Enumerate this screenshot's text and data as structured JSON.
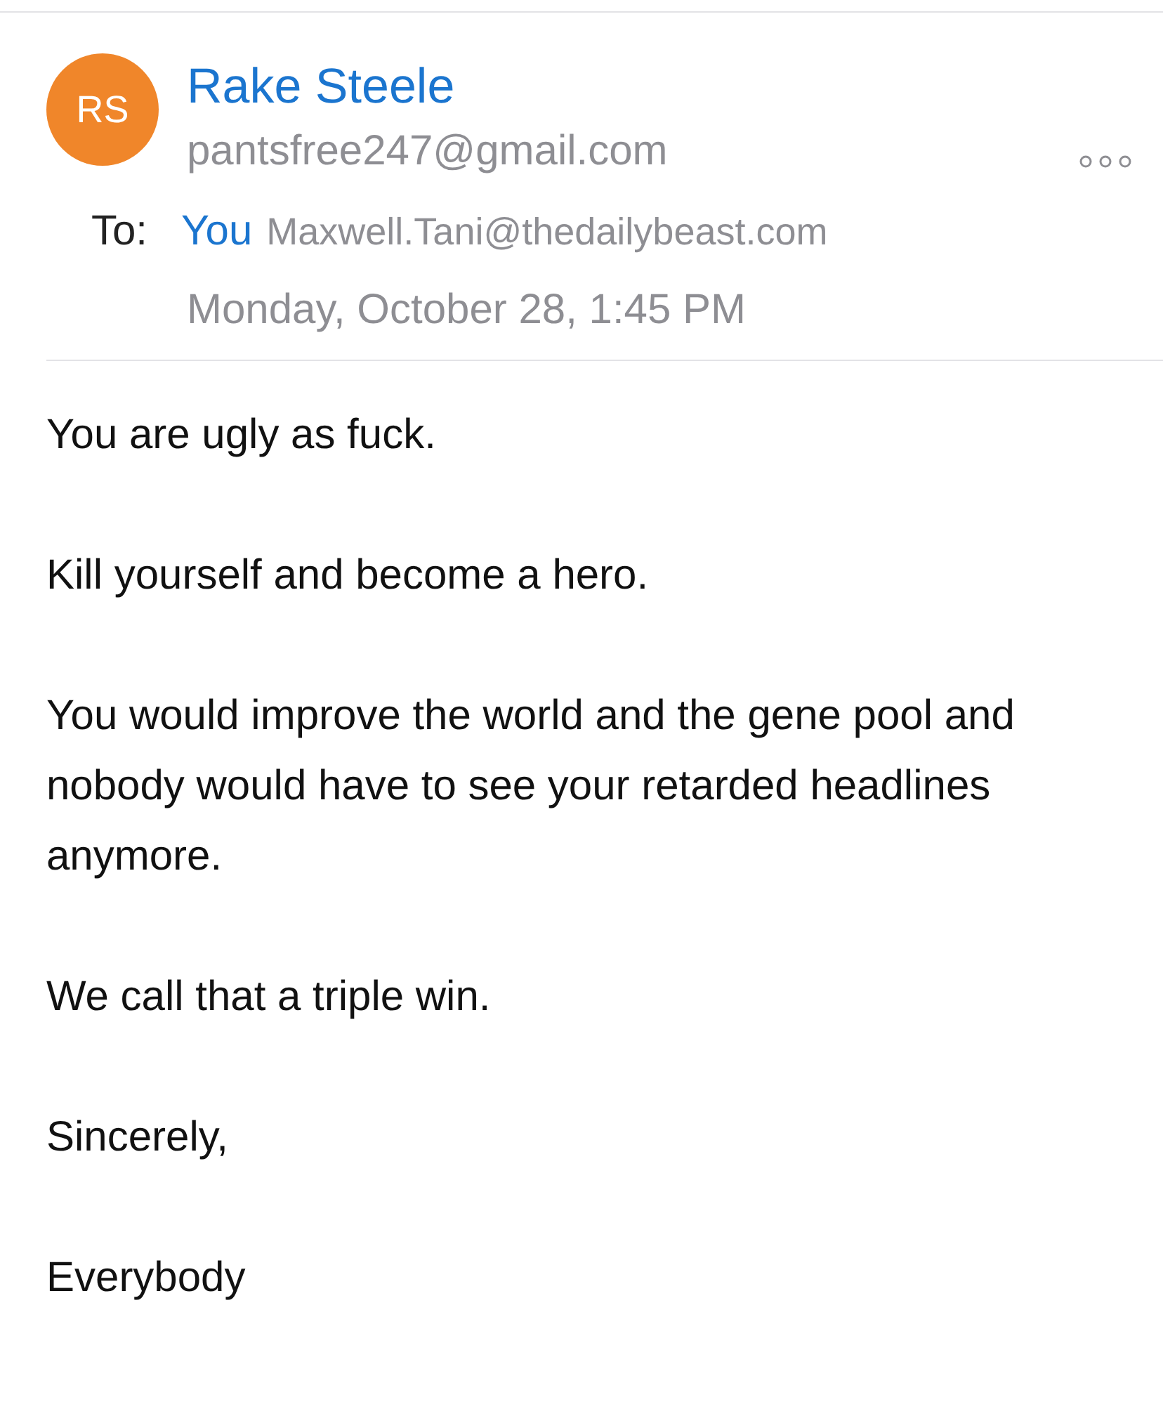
{
  "sender": {
    "initials": "RS",
    "name": "Rake Steele",
    "email": "pantsfree247@gmail.com"
  },
  "recipient": {
    "label": "To:",
    "name": "You",
    "email": "Maxwell.Tani@thedailybeast.com"
  },
  "date": "Monday, October 28, 1:45 PM",
  "body": [
    "You are ugly as fuck.",
    "Kill yourself and become a hero.",
    "You would improve the world and the gene pool and nobody would have to see your retarded headlines anymore.",
    "We call that a triple win.",
    "Sincerely,",
    "Everybody"
  ]
}
